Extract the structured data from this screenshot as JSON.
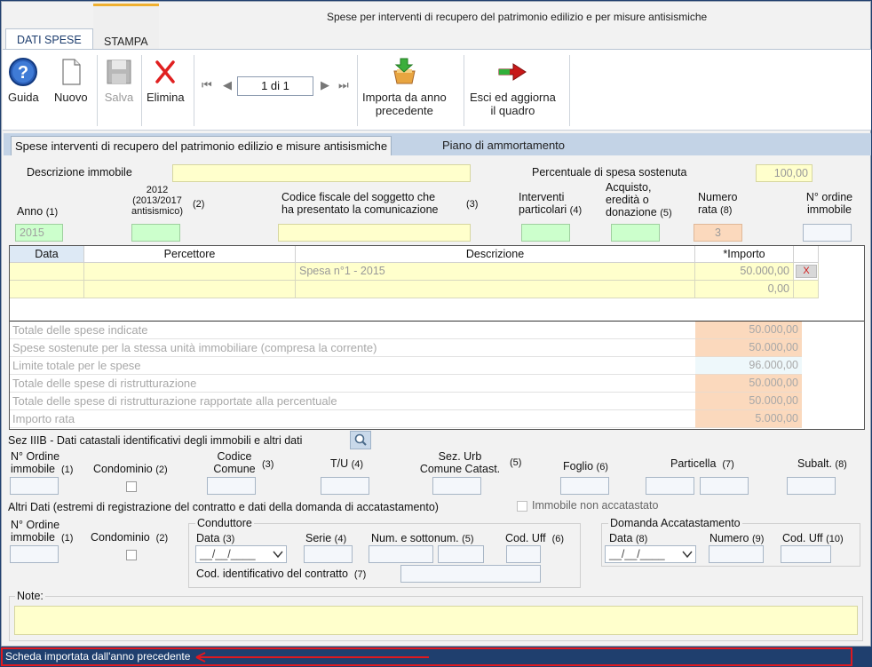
{
  "window": {
    "title": "Spese per interventi di recupero del patrimonio edilizio e per misure antisismiche"
  },
  "tabs": [
    {
      "label": "DATI SPESE"
    },
    {
      "label": "STAMPA"
    }
  ],
  "toolbar": {
    "guida": "Guida",
    "nuovo": "Nuovo",
    "salva": "Salva",
    "elimina": "Elimina",
    "page": "1 di 1",
    "importa_line1": "Importa da anno",
    "importa_line2": "precedente",
    "esci_line1": "Esci ed aggiorna",
    "esci_line2": "il quadro",
    "nav_first": "⏮",
    "nav_prev": "◀",
    "nav_next": "▶",
    "nav_last": "⏭"
  },
  "subtabs": [
    {
      "label": "Spese interventi di recupero del patrimonio edilizio e misure antisismiche"
    },
    {
      "label": "Piano di ammortamento"
    }
  ],
  "form": {
    "descrizione_immobile": {
      "label": "Descrizione immobile",
      "value": ""
    },
    "percentuale": {
      "label": "Percentuale di spesa sostenuta",
      "value": "100,00"
    },
    "anno": {
      "label": "Anno",
      "num": "(1)",
      "value": "2015"
    },
    "anno2012": {
      "label1": "2012",
      "label2": "(2013/2017",
      "label3": "antisismico)",
      "num": "(2)",
      "value": ""
    },
    "codice_fiscale": {
      "label1": "Codice fiscale del soggetto che",
      "label2": "ha presentato la comunicazione",
      "num": "(3)",
      "value": ""
    },
    "interventi": {
      "label1": "Interventi",
      "label2": "particolari",
      "num": "(4)",
      "value": ""
    },
    "acquisto": {
      "label1": "Acquisto,",
      "label2": "eredità o",
      "label3": "donazione",
      "num": "(5)",
      "value": ""
    },
    "numero_rata": {
      "label1": "Numero",
      "label2": "rata",
      "num": "(8)",
      "value": "3"
    },
    "ordine_immobile": {
      "label1": "N° ordine",
      "label2": "immobile",
      "value": ""
    }
  },
  "grid": {
    "headers": [
      "Data",
      "Percettore",
      "Descrizione",
      "*Importo"
    ],
    "rows": [
      {
        "data": "",
        "percettore": "",
        "descrizione": "Spesa n°1 - 2015",
        "importo": "50.000,00",
        "delete": "X"
      },
      {
        "data": "",
        "percettore": "",
        "descrizione": "",
        "importo": "0,00",
        "delete": ""
      }
    ]
  },
  "totals": [
    {
      "label": "Totale delle spese indicate",
      "value": "50.000,00"
    },
    {
      "label": "Spese sostenute per la stessa unità immobiliare (compresa la corrente)",
      "value": "50.000,00"
    },
    {
      "label": "Limite totale per le spese",
      "value": "96.000,00"
    },
    {
      "label": "Totale delle spese di ristrutturazione",
      "value": "50.000,00"
    },
    {
      "label": "Totale delle spese di ristrutturazione rapportate alla percentuale",
      "value": "50.000,00"
    },
    {
      "label": "Importo rata",
      "value": "5.000,00"
    }
  ],
  "catastali": {
    "title": "Sez IIIB - Dati catastali identificativi degli immobili e altri dati",
    "ordine_l1": "N° Ordine",
    "ordine_l2": "immobile",
    "ordine_num": "(1)",
    "condominio": "Condominio",
    "condominio_num": "(2)",
    "codice_l1": "Codice",
    "codice_l2": "Comune",
    "codice_num": "(3)",
    "tu": "T/U",
    "tu_num": "(4)",
    "sezurb_l1": "Sez. Urb",
    "sezurb_l2": "Comune Catast.",
    "sezurb_num": "(5)",
    "foglio": "Foglio",
    "foglio_num": "(6)",
    "particella": "Particella",
    "particella_num": "(7)",
    "subalt": "Subalt.",
    "subalt_num": "(8)"
  },
  "altri": {
    "title": "Altri Dati (estremi di registrazione del contratto e dati della domanda di accatastamento)",
    "non_accatastato": "Immobile non accatastato",
    "ordine_l1": "N° Ordine",
    "ordine_l2": "immobile",
    "ordine_num": "(1)",
    "condominio": "Condominio",
    "condominio_num": "(2)",
    "conduttore": {
      "title": "Conduttore",
      "data": "Data",
      "data_num": "(3)",
      "data_value": "__/__/____",
      "serie": "Serie",
      "serie_num": "(4)",
      "num": "Num. e sottonum.",
      "num_num": "(5)",
      "codUff": "Cod. Uff",
      "codUff_num": "(6)",
      "contratto": "Cod. identificativo del contratto",
      "contratto_num": "(7)"
    },
    "domanda": {
      "title": "Domanda Accatastamento",
      "data": "Data",
      "data_num": "(8)",
      "data_value": "__/__/____",
      "numero": "Numero",
      "numero_num": "(9)",
      "codUff": "Cod. Uff",
      "codUff_num": "(10)"
    }
  },
  "note": {
    "label": "Note:",
    "value": ""
  },
  "status": {
    "text": "Scheda importata dall'anno precedente"
  },
  "colors": {
    "status_bg": "#1f3f6e",
    "highlight": "#e0191f",
    "field_yellow": "#ffffcc",
    "field_green": "#ccffcc",
    "field_orange": "#fbd9bd"
  }
}
